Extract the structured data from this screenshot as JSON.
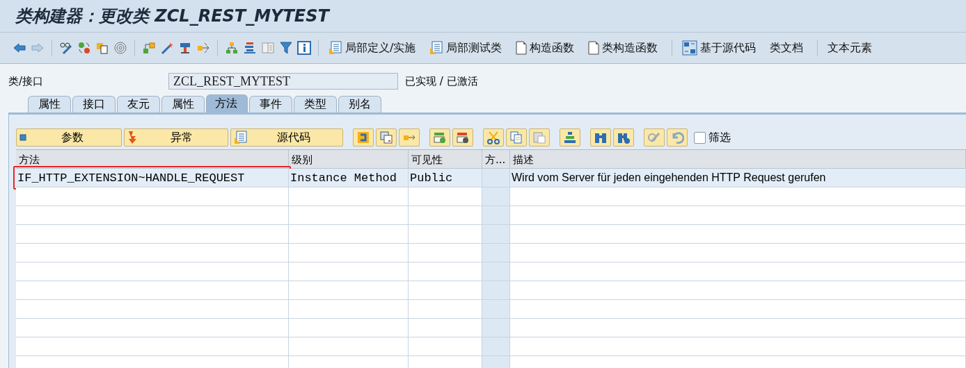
{
  "window": {
    "title": "类构建器：更改类 ZCL_REST_MYTEST"
  },
  "toolbar": {
    "buttons": [
      {
        "label": "局部定义/实施"
      },
      {
        "label": "局部测试类"
      },
      {
        "label": "构造函数"
      },
      {
        "label": "类构造函数"
      },
      {
        "label": "基于源代码"
      },
      {
        "label": "类文档"
      },
      {
        "label": "文本元素"
      }
    ]
  },
  "class_field": {
    "label": "类/接口",
    "value": "ZCL_REST_MYTEST",
    "status": "已实现 / 已激活"
  },
  "tabs": [
    {
      "label": "属性",
      "selected": false
    },
    {
      "label": "接口",
      "selected": false
    },
    {
      "label": "友元",
      "selected": false
    },
    {
      "label": "属性",
      "selected": false
    },
    {
      "label": "方法",
      "selected": true
    },
    {
      "label": "事件",
      "selected": false
    },
    {
      "label": "类型",
      "selected": false
    },
    {
      "label": "别名",
      "selected": false
    }
  ],
  "method_toolbar": {
    "buttons": [
      {
        "label": "参数"
      },
      {
        "label": "异常"
      },
      {
        "label": "源代码"
      }
    ],
    "filter": {
      "label": "筛选",
      "checked": false
    }
  },
  "table": {
    "columns": [
      "方法",
      "级别",
      "可见性",
      "方...",
      "描述"
    ],
    "rows": [
      {
        "cells": [
          "IF_HTTP_EXTENSION~HANDLE_REQUEST",
          "Instance Method",
          "Public",
          "",
          "Wird vom Server für jeden eingehenden HTTP Request gerufen"
        ],
        "highlighted": true
      }
    ]
  }
}
